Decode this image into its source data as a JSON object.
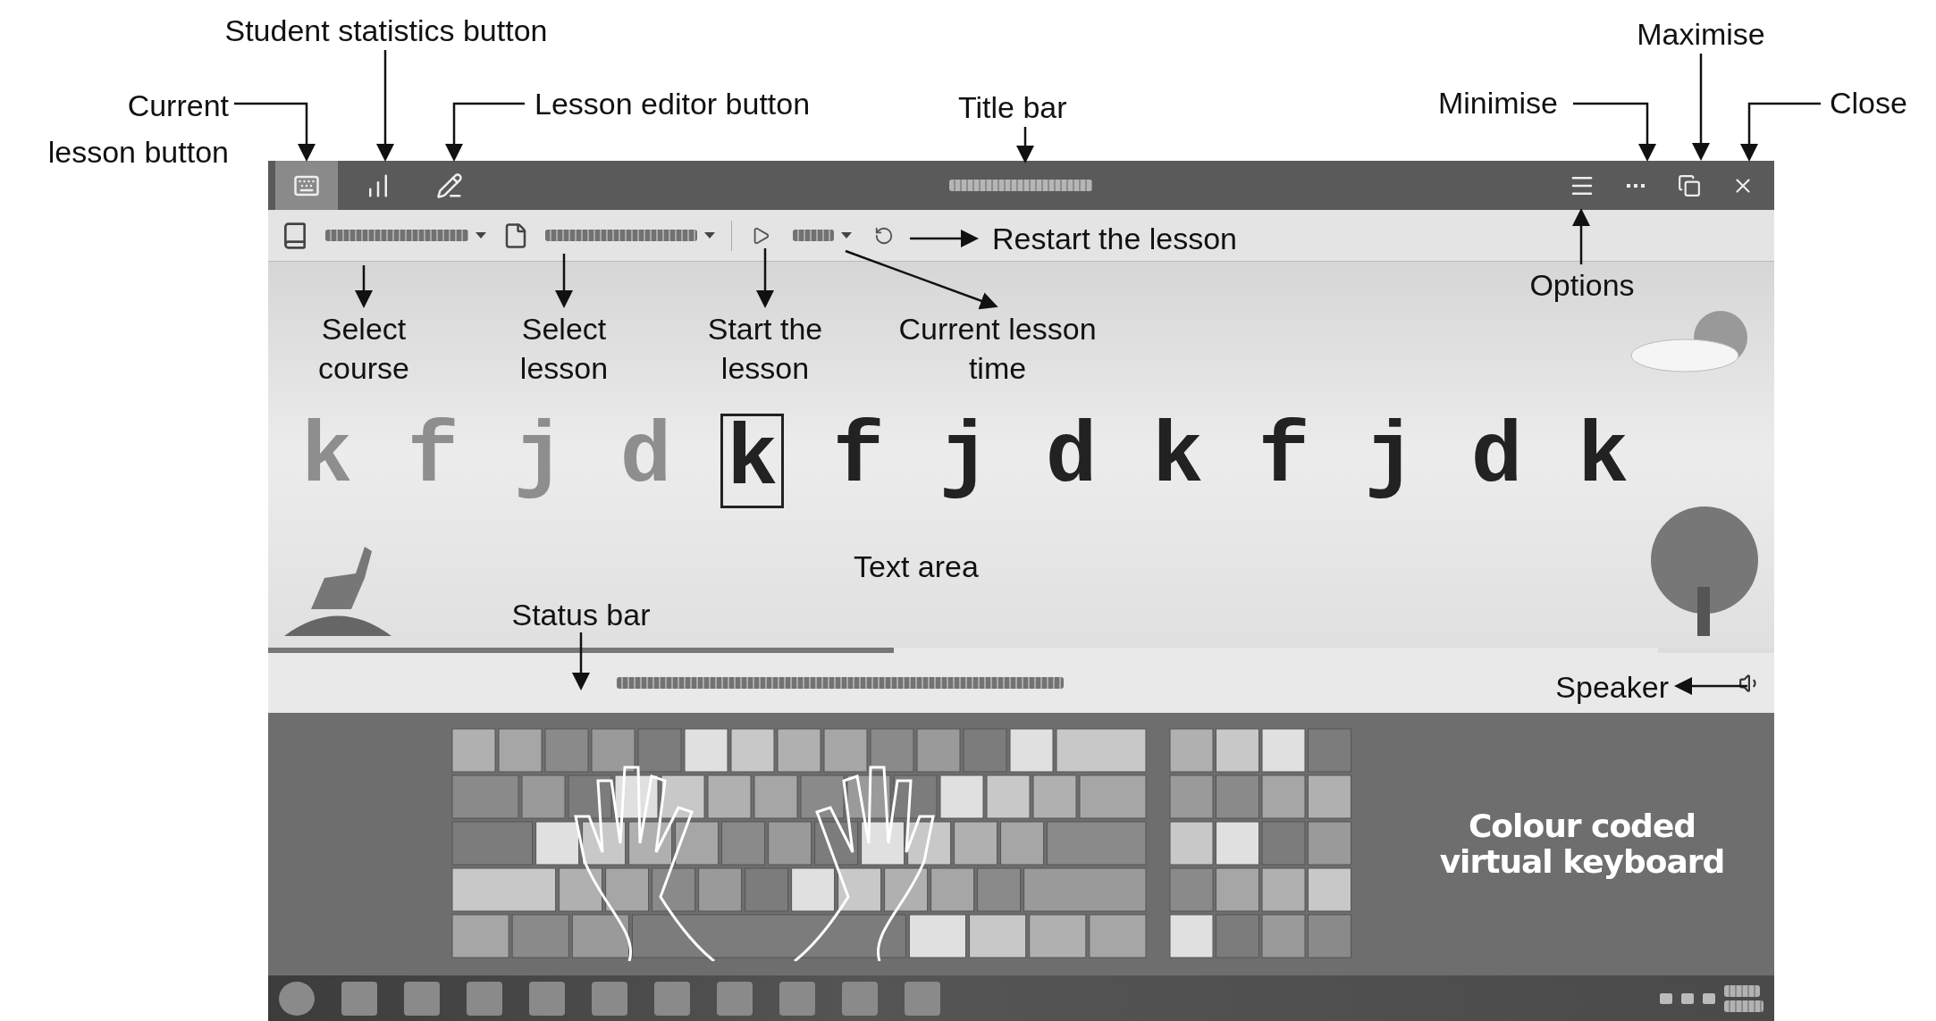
{
  "callouts": {
    "current_lesson": "Current lesson button",
    "student_statistics": "Student statistics button",
    "lesson_editor": "Lesson editor button",
    "title_bar": "Title bar",
    "minimise": "Minimise",
    "maximise": "Maximise",
    "close": "Close",
    "restart": "Restart the lesson",
    "options": "Options",
    "select_course": "Select course",
    "select_lesson": "Select lesson",
    "start_lesson": "Start the lesson",
    "lesson_time": "Current lesson time",
    "text_area": "Text area",
    "status_bar": "Status bar",
    "speaker": "Speaker"
  },
  "title_buttons": [
    {
      "kind": "lesson",
      "selected": true
    },
    {
      "kind": "statistics",
      "selected": false
    },
    {
      "kind": "editor",
      "selected": false
    }
  ],
  "letters": [
    {
      "char": "k",
      "typed": true,
      "current": false
    },
    {
      "char": "f",
      "typed": true,
      "current": false
    },
    {
      "char": "j",
      "typed": true,
      "current": false
    },
    {
      "char": "d",
      "typed": true,
      "current": false
    },
    {
      "char": "k",
      "typed": false,
      "current": true
    },
    {
      "char": "f",
      "typed": false,
      "current": false
    },
    {
      "char": "j",
      "typed": false,
      "current": false
    },
    {
      "char": "d",
      "typed": false,
      "current": false
    },
    {
      "char": "k",
      "typed": false,
      "current": false
    },
    {
      "char": "f",
      "typed": false,
      "current": false
    },
    {
      "char": "j",
      "typed": false,
      "current": false
    },
    {
      "char": "d",
      "typed": false,
      "current": false
    },
    {
      "char": "k",
      "typed": false,
      "current": false
    }
  ],
  "progress": {
    "level": 0.45
  },
  "keyboard_label": "Colour coded virtual keyboard"
}
